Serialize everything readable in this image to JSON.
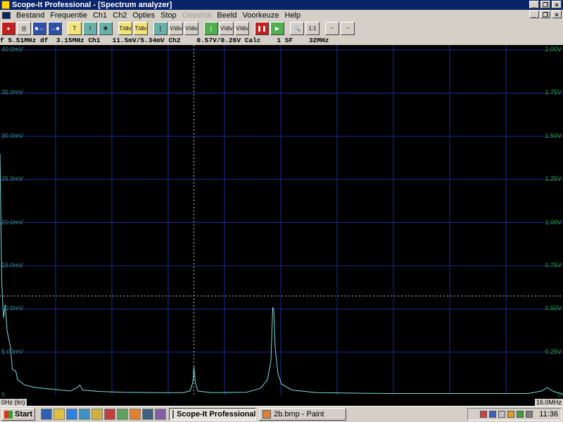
{
  "window": {
    "title": "Scope-It Professional - [Spectrum analyzer]"
  },
  "menu": {
    "items": [
      {
        "label": "Bestand",
        "disabled": false
      },
      {
        "label": "Frequentie",
        "disabled": false
      },
      {
        "label": "Ch1",
        "disabled": false
      },
      {
        "label": "Ch2",
        "disabled": false
      },
      {
        "label": "Opties",
        "disabled": false
      },
      {
        "label": "Stop",
        "disabled": false
      },
      {
        "label": "Oneshot",
        "disabled": true
      },
      {
        "label": "Beeld",
        "disabled": false
      },
      {
        "label": "Voorkeuze",
        "disabled": false
      },
      {
        "label": "Help",
        "disabled": false
      }
    ]
  },
  "toolbar": {
    "buttons": [
      {
        "name": "record-icon",
        "label": "●",
        "style": "red"
      },
      {
        "name": "bars-icon",
        "label": "|||",
        "style": ""
      },
      {
        "name": "arrow-right-icon",
        "label": "■→",
        "style": "blue"
      },
      {
        "name": "arrow-left-icon",
        "label": "→■",
        "style": "blue"
      },
      {
        "name": "sep",
        "label": "",
        "style": "sep"
      },
      {
        "name": "cursor-t-icon",
        "label": "T",
        "style": "yellow"
      },
      {
        "name": "cursor-i-icon",
        "label": "I",
        "style": "teal"
      },
      {
        "name": "cursor-move-icon",
        "label": "✥",
        "style": "teal"
      },
      {
        "name": "sep",
        "label": "",
        "style": "sep"
      },
      {
        "name": "time-div-up-icon",
        "label": "T/div",
        "style": "yellow"
      },
      {
        "name": "time-div-down-icon",
        "label": "T/div",
        "style": "yellow"
      },
      {
        "name": "sep",
        "label": "",
        "style": "sep"
      },
      {
        "name": "ch1-cursor-icon",
        "label": "[",
        "style": "teal"
      },
      {
        "name": "ch1-vdiv-minus-icon",
        "label": "V/div-",
        "style": ""
      },
      {
        "name": "ch1-vdiv-plus-icon",
        "label": "V/div+",
        "style": ""
      },
      {
        "name": "sep",
        "label": "",
        "style": "sep"
      },
      {
        "name": "ch2-cursor-icon",
        "label": "[",
        "style": "green"
      },
      {
        "name": "ch2-vdiv-minus-icon",
        "label": "V/div-",
        "style": ""
      },
      {
        "name": "ch2-vdiv-plus-icon",
        "label": "V/div+",
        "style": ""
      },
      {
        "name": "sep",
        "label": "",
        "style": "sep"
      },
      {
        "name": "pause-icon",
        "label": "❚❚",
        "style": "red"
      },
      {
        "name": "play-icon",
        "label": "▶",
        "style": "green"
      },
      {
        "name": "sep",
        "label": "",
        "style": "sep"
      },
      {
        "name": "zoom-icon",
        "label": "🔍",
        "style": ""
      },
      {
        "name": "zoom-fit-icon",
        "label": "1:1",
        "style": ""
      },
      {
        "name": "sep",
        "label": "",
        "style": "sep"
      },
      {
        "name": "signal-icon",
        "label": "~",
        "style": ""
      },
      {
        "name": "signal-alt-icon",
        "label": "~",
        "style": ""
      }
    ]
  },
  "status": {
    "text": "f 5.51MHz df  3.15MHz Ch1   11.5mV/5.34mV Ch2    0.57V/0.26V Calc    1 SF    32MHz"
  },
  "scope": {
    "left_axis": [
      "40.0mV",
      "35.0mV",
      "30.0mV",
      "25.0mV",
      "20.0mV",
      "15.0mV",
      "10.0mV",
      "5.00mV",
      "0"
    ],
    "right_axis": [
      "2.00V",
      "1.75V",
      "1.50V",
      "1.25V",
      "1.00V",
      "0.75V",
      "0.50V",
      "0.25V",
      "0"
    ],
    "x_start": "0Hz (lin)",
    "x_end": "16.0MHz",
    "colors": {
      "trace": "#7fd8d8",
      "grid": "#1d2a8c",
      "cursor": "#c0c0c0",
      "left_label": "#3c8c8c",
      "right_label": "#2aa830"
    }
  },
  "chart_data": {
    "type": "line",
    "title": "",
    "xlabel": "",
    "ylabel": "",
    "xlim": [
      0,
      16.0
    ],
    "ylim": [
      0,
      40.0
    ],
    "x_unit": "MHz",
    "y_unit": "mV",
    "cursor": {
      "x": 5.51,
      "y": 11.5
    },
    "series": [
      {
        "points": [
          [
            0,
            28.0
          ],
          [
            0.05,
            13.0
          ],
          [
            0.1,
            9.0
          ],
          [
            0.15,
            10.5
          ],
          [
            0.2,
            7.5
          ],
          [
            0.3,
            5.5
          ],
          [
            0.35,
            3.0
          ],
          [
            0.45,
            2.8
          ],
          [
            0.5,
            1.8
          ],
          [
            0.7,
            1.2
          ],
          [
            1.0,
            0.9
          ],
          [
            1.5,
            0.7
          ],
          [
            2.0,
            0.5
          ],
          [
            2.2,
            0.9
          ],
          [
            2.27,
            1.2
          ],
          [
            2.35,
            0.6
          ],
          [
            2.8,
            0.45
          ],
          [
            3.5,
            0.35
          ],
          [
            4.5,
            0.3
          ],
          [
            5.2,
            0.3
          ],
          [
            5.4,
            0.5
          ],
          [
            5.48,
            1.5
          ],
          [
            5.51,
            3.3
          ],
          [
            5.55,
            1.5
          ],
          [
            5.62,
            0.5
          ],
          [
            6.0,
            0.3
          ],
          [
            7.0,
            0.35
          ],
          [
            7.4,
            0.8
          ],
          [
            7.6,
            1.8
          ],
          [
            7.7,
            4.0
          ],
          [
            7.75,
            10.2
          ],
          [
            7.78,
            9.8
          ],
          [
            7.82,
            5.5
          ],
          [
            7.9,
            2.5
          ],
          [
            8.0,
            1.3
          ],
          [
            8.3,
            0.6
          ],
          [
            9.0,
            0.3
          ],
          [
            11.0,
            0.2
          ],
          [
            13.0,
            0.2
          ],
          [
            15.0,
            0.2
          ],
          [
            15.4,
            0.5
          ],
          [
            15.55,
            0.9
          ],
          [
            15.7,
            0.5
          ],
          [
            16.0,
            0.1
          ]
        ]
      }
    ]
  },
  "taskbar": {
    "start": "Start",
    "tasks": [
      {
        "label": "Scope-It Professional...",
        "active": true
      },
      {
        "label": "2b.bmp - Paint",
        "active": false
      }
    ],
    "clock": "11:36"
  }
}
